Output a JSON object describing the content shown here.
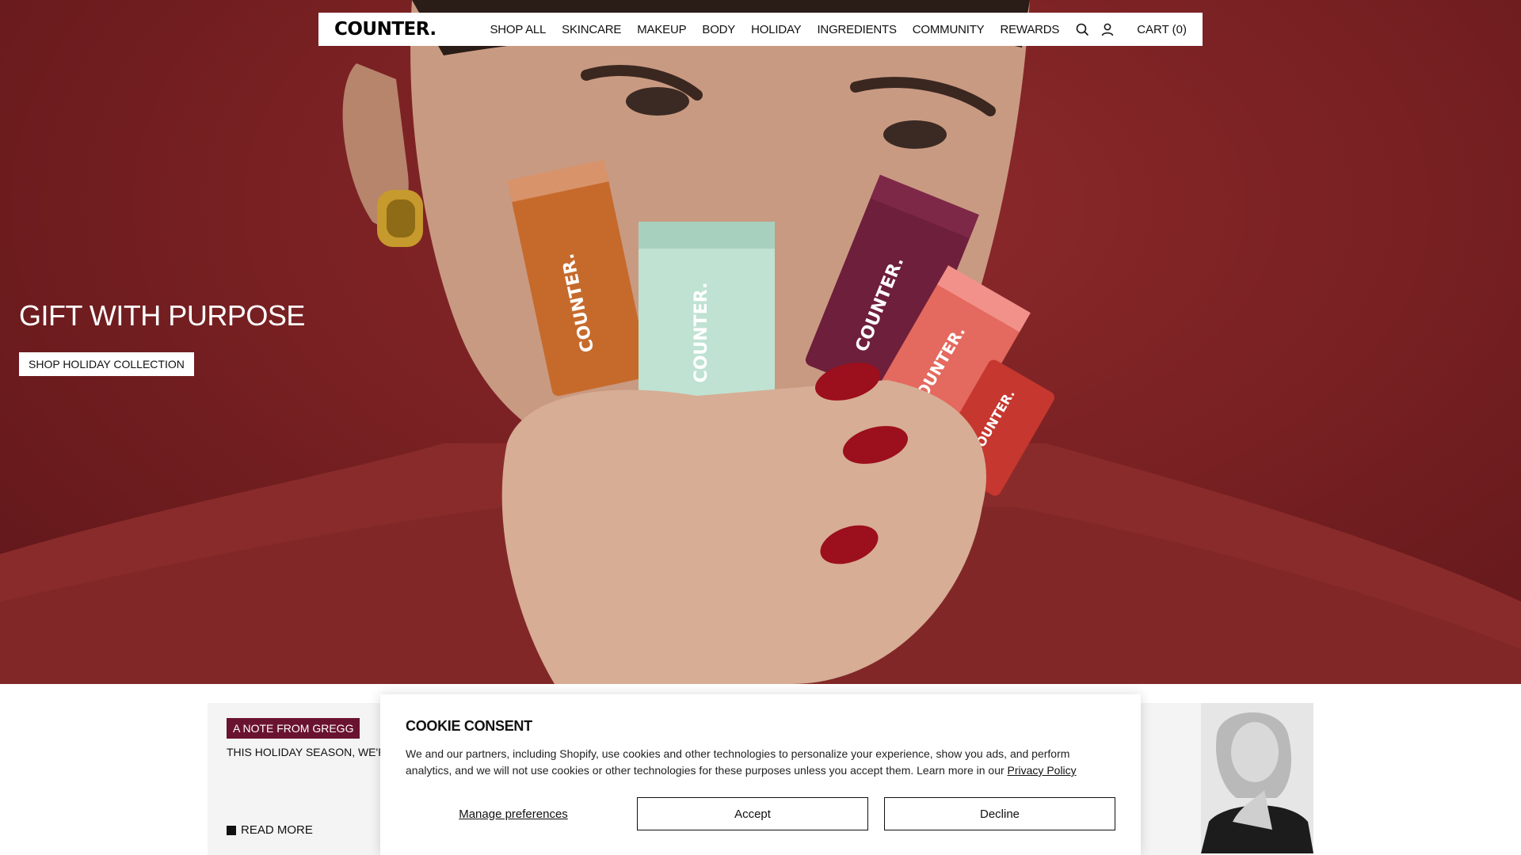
{
  "brand": {
    "logo_text": "COUNTER."
  },
  "nav": {
    "links": [
      "SHOP ALL",
      "SKINCARE",
      "MAKEUP",
      "BODY",
      "HOLIDAY",
      "INGREDIENTS",
      "COMMUNITY",
      "REWARDS"
    ],
    "cart_label": "CART (0)",
    "icons": [
      "search-icon",
      "account-icon"
    ]
  },
  "hero": {
    "title": "GIFT WITH PURPOSE",
    "button_label": "SHOP HOLIDAY COLLECTION",
    "background_color": "#7a2123"
  },
  "note": {
    "badge": "A NOTE FROM GREGG",
    "text": "THIS HOLIDAY SEASON, WE'RE C",
    "read_more": "READ MORE",
    "badge_color": "#6a1330"
  },
  "cookie": {
    "title": "COOKIE CONSENT",
    "body": "We and our partners, including Shopify, use cookies and other technologies to personalize your experience, show you ads, and perform analytics, and we will not use cookies or other technologies for these purposes unless you accept them. Learn more in our",
    "policy_link": "Privacy Policy",
    "manage_label": "Manage preferences",
    "accept_label": "Accept",
    "decline_label": "Decline"
  }
}
